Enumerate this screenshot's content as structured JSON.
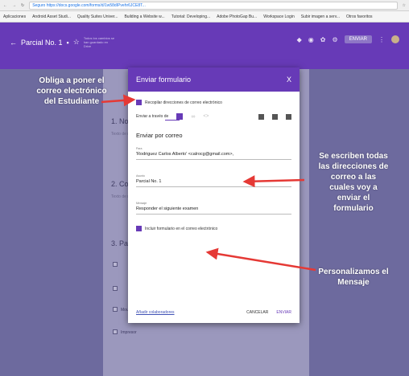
{
  "browser": {
    "url": "Seguro https://docs.google.com/forms/d/1w58dIPvehr6JCE8T...",
    "bookmarks": [
      "Aplicaciones",
      "Android Asset Studi...",
      "Quality Suites Univer...",
      "Building a Website w...",
      "Tutorial: Developing...",
      "Adobe PhotoGap Bu...",
      "Workspace Login",
      "Subir imagen a serv...",
      "Otros favoritos"
    ]
  },
  "header": {
    "form_title": "Parcial No. 1",
    "subtitle": "Todos los cambios se han guardado en Drive",
    "send_label": "ENVIAR"
  },
  "background_form": {
    "q1": "1. No",
    "q2": "2. Co",
    "q3": "3. Pa",
    "q_sub": "Texto de respuesta corta",
    "options": [
      "Word",
      "Excel",
      "Mouse",
      "Impresor"
    ]
  },
  "dialog": {
    "title": "Enviar formulario",
    "close": "X",
    "collect_emails": "Recopilar direcciones de correo electrónico",
    "send_via": "Enviar a través de",
    "heading": "Enviar por correo",
    "to_label": "Para",
    "to_value": "'Rodriguez Carlos Alberto' <calrocg@gmail.com>,",
    "subject_label": "Asunto",
    "subject_value": "Parcial No. 1",
    "message_label": "Mensaje",
    "message_value": "Responder el siguiente examen",
    "include_form": "Incluir formulario en el correo electrónico",
    "add_collaborators": "Añadir colaboradores",
    "cancel": "CANCELAR",
    "send": "ENVIAR"
  },
  "annotations": {
    "left_note": "Obliga a poner el correo electrónico del Estudiante",
    "right_note_1": "Se escriben todas las direcciones de correo a las cuales voy a enviar el formulario",
    "right_note_2": "Personalizamos el Mensaje"
  },
  "colors": {
    "accent": "#673ab7",
    "arrow": "#e53935",
    "overlay": "#6d6a9e"
  }
}
